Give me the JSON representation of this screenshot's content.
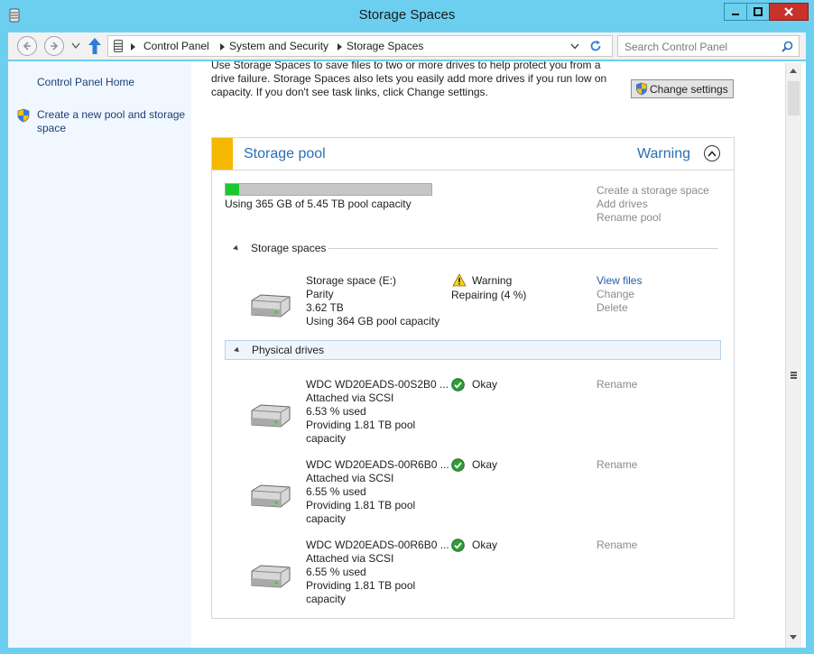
{
  "window": {
    "title": "Storage Spaces"
  },
  "address_bar": {
    "crumbs": [
      "Control Panel",
      "System and Security",
      "Storage Spaces"
    ],
    "search_placeholder": "Search Control Panel"
  },
  "sidebar": {
    "items": [
      {
        "label": "Control Panel Home"
      },
      {
        "label": "Create a new pool and storage space"
      }
    ]
  },
  "main": {
    "intro_lines": [
      "Use Storage Spaces to save files to two or more drives to help protect you from a",
      "drive failure. Storage Spaces also lets you easily add more drives if you run low on",
      "capacity. If you don't see task links, click Change settings."
    ],
    "change_settings_label": "Change settings"
  },
  "pool": {
    "title": "Storage pool",
    "status": "Warning",
    "capacity_text": "Using 365 GB of 5.45 TB pool capacity",
    "capacity_fraction": 0.065,
    "tasks": [
      "Create a storage space",
      "Add drives",
      "Rename pool"
    ],
    "storage_spaces_header": "Storage spaces",
    "physical_drives_header": "Physical drives",
    "spaces": [
      {
        "name": "Storage space (E:)",
        "resiliency": "Parity",
        "size": "3.62 TB",
        "usage": "Using 364 GB pool capacity",
        "status": "Warning",
        "status_detail": "Repairing (4 %)",
        "actions": [
          "View files",
          "Change",
          "Delete"
        ]
      }
    ],
    "drives": [
      {
        "name": "WDC WD20EADS-00S2B0 ...",
        "attach": "Attached via SCSI",
        "used": "6.53 % used",
        "providing_1": "Providing 1.81 TB pool",
        "providing_2": "capacity",
        "status": "Okay",
        "action": "Rename"
      },
      {
        "name": "WDC WD20EADS-00R6B0 ...",
        "attach": "Attached via SCSI",
        "used": "6.55 % used",
        "providing_1": "Providing 1.81 TB pool",
        "providing_2": "capacity",
        "status": "Okay",
        "action": "Rename"
      },
      {
        "name": "WDC WD20EADS-00R6B0 ...",
        "attach": "Attached via SCSI",
        "used": "6.55 % used",
        "providing_1": "Providing 1.81 TB pool",
        "providing_2": "capacity",
        "status": "Okay",
        "action": "Rename"
      }
    ]
  },
  "colors": {
    "accent_link": "#1f5fa8",
    "pool_warning_bar": "#f5b800",
    "capacity_fill": "#19c92c",
    "window_frame": "#6ccfee"
  }
}
